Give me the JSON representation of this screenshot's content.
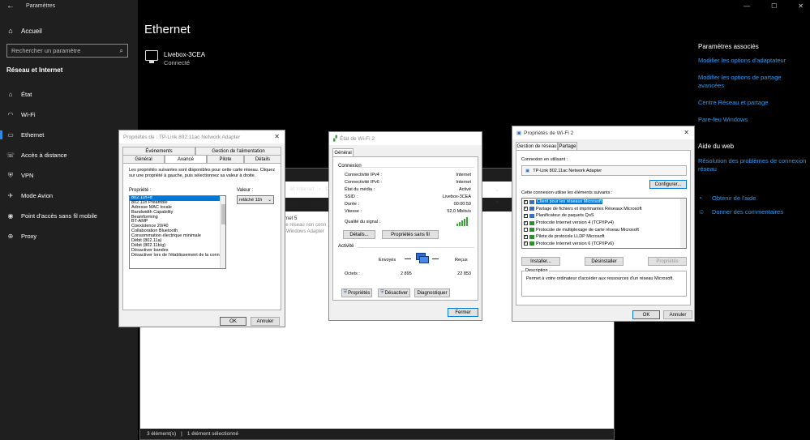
{
  "settings": {
    "app_title": "Paramètres",
    "home": "Accueil",
    "search_placeholder": "Rechercher un paramètre",
    "section": "Réseau et Internet",
    "nav": [
      {
        "label": "État",
        "icon": "home-status-icon"
      },
      {
        "label": "Wi-Fi",
        "icon": "wifi-icon"
      },
      {
        "label": "Ethernet",
        "icon": "ethernet-icon",
        "active": true
      },
      {
        "label": "Accès à distance",
        "icon": "dialup-icon"
      },
      {
        "label": "VPN",
        "icon": "vpn-icon"
      },
      {
        "label": "Mode Avion",
        "icon": "airplane-icon"
      },
      {
        "label": "Point d'accès sans fil mobile",
        "icon": "hotspot-icon"
      },
      {
        "label": "Proxy",
        "icon": "globe-icon"
      }
    ],
    "page_title": "Ethernet",
    "connection": {
      "name": "Livebox-3CEA",
      "status": "Connecté"
    },
    "related": {
      "title": "Paramètres associés",
      "links": [
        "Modifier les options d'adaptateur",
        "Modifier les options de partage avancées",
        "Centre Réseau et partage",
        "Pare-feu Windows"
      ]
    },
    "help": {
      "title": "Aide du web",
      "link": "Résolution des problèmes de connexion réseau",
      "get_help": "Obtenir de l'aide",
      "feedback": "Donner des commentaires"
    },
    "accent": "#2e8ae6"
  },
  "explorer": {
    "crumbs": [
      "et Internet",
      "Co"
    ],
    "toolbar": [
      "éseau",
      "Diagno"
    ],
    "item_lines": [
      "rnet 5",
      "le réseau non conn",
      "-Windows Adapter"
    ],
    "status_count": "3 élément(s)",
    "status_sel": "1 élément sélectionné"
  },
  "dlg1": {
    "title": "Propriétés de : TP-Link 802.11ac Network Adapter",
    "tabs_row1": [
      "Événements",
      "Gestion de l'alimentation"
    ],
    "tabs_row2": [
      "Général",
      "Avancé",
      "Pilote",
      "Détails"
    ],
    "description": "Les propriétés suivantes sont disponibles pour cette carte réseau. Cliquez sur une propriété à gauche, puis sélectionnez sa valeur à droite.",
    "prop_label": "Propriété :",
    "value_label": "Valeur :",
    "properties": [
      "802.11n+d",
      "802.11n Preamble",
      "Adresse MAC locale",
      "Bandwidth Capability",
      "Beamforming",
      "BT-AMP",
      "Coexistence 20/40",
      "Collaboration Bluetooth",
      "Consommation électrique minimale",
      "Débit (802.11a)",
      "Débit (802.11b/g)",
      "Désactiver bandes",
      "Désactiver lors de l'établissement de la conn"
    ],
    "value": "relâché 11h",
    "ok": "OK",
    "cancel": "Annuler"
  },
  "dlg2": {
    "title": "État de Wi-Fi 2",
    "tab": "Général",
    "connection_group": "Connexion",
    "rows": [
      {
        "k": "Connectivité IPv4 :",
        "v": "Internet"
      },
      {
        "k": "Connectivité IPv6 :",
        "v": "Internet"
      },
      {
        "k": "État du média :",
        "v": "Activé"
      },
      {
        "k": "SSID :",
        "v": "Livebox-3CEA"
      },
      {
        "k": "Durée :",
        "v": "00:00:59"
      },
      {
        "k": "Vitesse :",
        "v": "52,0 Mbits/s"
      }
    ],
    "signal_label": "Qualité du signal :",
    "details_btn": "Détails...",
    "wireless_btn": "Propriétés sans fil",
    "activity_group": "Activité",
    "sent_label": "Envoyés",
    "recv_label": "Reçus",
    "octets_label": "Octets :",
    "sent": "2 895",
    "recv": "22 853",
    "props_btn": "Propriétés",
    "disable_btn": "Désactiver",
    "diag_btn": "Diagnostiquer",
    "close_btn": "Fermer"
  },
  "dlg3": {
    "title": "Propriétés de Wi-Fi 2",
    "tabs": [
      "Gestion de réseau",
      "Partage"
    ],
    "connect_using": "Connexion en utilisant :",
    "adapter": "TP-Link 802.11ac Network Adapter",
    "configure_btn": "Configurer...",
    "items_label": "Cette connexion utilise les éléments suivants :",
    "items": [
      {
        "label": "Client pour les réseaux Microsoft",
        "checked": true,
        "selected": true,
        "color": "#3a6fc4"
      },
      {
        "label": "Partage de fichiers et imprimantes Réseaux Microsoft",
        "checked": true,
        "color": "#3a6fc4"
      },
      {
        "label": "Planificateur de paquets QoS",
        "checked": true,
        "color": "#3a6fc4"
      },
      {
        "label": "Protocole Internet version 4 (TCP/IPv4)",
        "checked": true,
        "color": "#2f8f2f"
      },
      {
        "label": "Protocole de multiplexage de carte réseau Microsoft",
        "checked": false,
        "color": "#2f8f2f"
      },
      {
        "label": "Pilote de protocole LLDP Microsoft",
        "checked": true,
        "color": "#2f8f2f"
      },
      {
        "label": "Protocole Internet version 6 (TCP/IPv6)",
        "checked": true,
        "color": "#2f8f2f"
      }
    ],
    "install_btn": "Installer...",
    "uninstall_btn": "Désinstaller",
    "properties_btn": "Propriétés",
    "description_header": "Description",
    "description": "Permet à votre ordinateur d'accéder aux ressources d'un réseau Microsoft.",
    "ok": "OK",
    "cancel": "Annuler"
  }
}
